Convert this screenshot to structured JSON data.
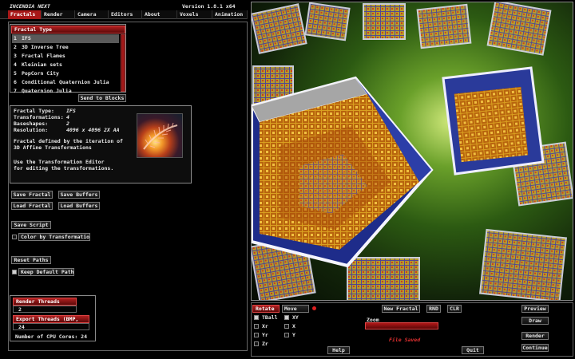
{
  "app": {
    "title": "INCENDIA NEXT",
    "version": "Version 1.8.1 x64"
  },
  "menu": [
    "Fractals",
    "Render",
    "Camera",
    "Editors",
    "About",
    "Voxels",
    "Animation"
  ],
  "fractal_type": {
    "title": "Fractal Type",
    "items": [
      {
        "num": "1",
        "label": "IFS"
      },
      {
        "num": "2",
        "label": "3D Inverse Tree"
      },
      {
        "num": "3",
        "label": "Fractal Flames"
      },
      {
        "num": "4",
        "label": "Kleinian sets"
      },
      {
        "num": "5",
        "label": "PopCorn City"
      },
      {
        "num": "6",
        "label": "Conditional Quaternion Julia"
      },
      {
        "num": "7",
        "label": "Quaternion Julia"
      }
    ],
    "send_button": "Send to Blocks"
  },
  "info": {
    "fractal_type_label": "Fractal Type:",
    "fractal_type_value": "IFS",
    "transformations_label": "Transformations:",
    "transformations_value": "4",
    "baseshapes_label": "Baseshapes:",
    "baseshapes_value": "2",
    "resolution_label": "Resolution:",
    "resolution_value": "4096 x 4096 2X AA",
    "desc_line1": "Fractal defined by the iteration of",
    "desc_line2": "3D Affine Transformations",
    "desc_line3": "Use the Transformation Editor",
    "desc_line4": "for editing the transformations."
  },
  "buttons": {
    "save_fractal": "Save Fractal",
    "save_buffers": "Save Buffers",
    "load_fractal": "Load Fractal",
    "load_buffers": "Load Buffers",
    "save_script": "Save Script",
    "color_by_transformation": "Color by Transformation",
    "reset_paths": "Reset Paths",
    "keep_default_paths": "Keep Default Paths"
  },
  "threads": {
    "render_label": "Render Threads",
    "render_value": "2",
    "export_label": "Export Threads (BMP, PNG)",
    "export_value": "24",
    "cpu_cores": "Number of CPU Cores: 24"
  },
  "controls": {
    "rotate": "Rotate",
    "move": "Move",
    "rotate_items": [
      "TBall",
      "Xr",
      "Yr",
      "Zr"
    ],
    "move_items": [
      "XY",
      "X",
      "Y"
    ],
    "new_fractal": "New Fractal",
    "rnd": "RND",
    "clr": "CLR",
    "zoom": "Zoom",
    "status": "File Saved",
    "help": "Help",
    "quit": "Quit",
    "preview": "Preview",
    "draw": "Draw",
    "render": "Render",
    "continue": "Continue"
  },
  "colors": {
    "accent": "#a81818",
    "background": "#000000"
  }
}
